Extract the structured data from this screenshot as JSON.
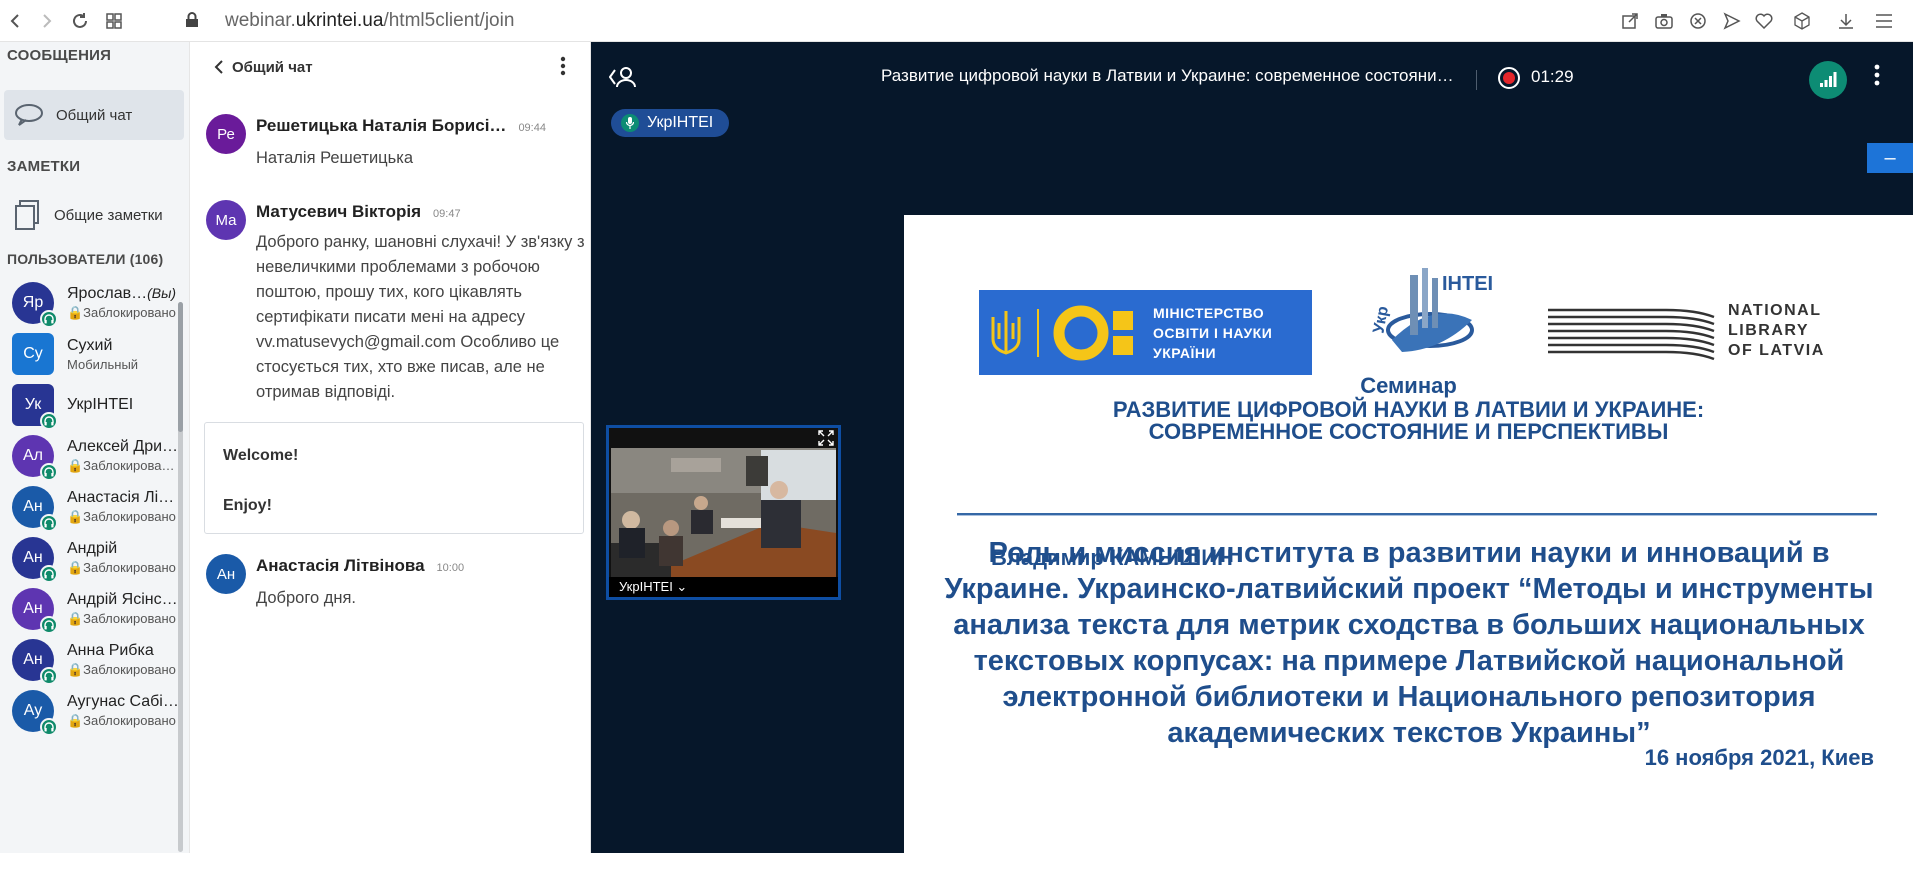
{
  "browser": {
    "url_host_prefix": "webinar.",
    "url_host_main": "ukrintei.ua",
    "url_path": "/html5client/join"
  },
  "sidebar": {
    "messages_title": "СООБЩЕНИЯ",
    "public_chat_label": "Общий чат",
    "notes_title": "ЗАМЕТКИ",
    "shared_notes_label": "Общие заметки",
    "users_title": "ПОЛЬЗОВАТЕЛИ (106)",
    "users": [
      {
        "initials": "Яр",
        "name": "Ярослав…",
        "you": "(Вы)",
        "status": "🔒Заблокировано",
        "color": "#283593",
        "badge": true
      },
      {
        "initials": "Су",
        "name": "Сухий",
        "status": "Мобильный",
        "color": "#1976d2",
        "badge": false,
        "square": true
      },
      {
        "initials": "Ук",
        "name": "УкрІНТЕІ",
        "status": "",
        "color": "#283593",
        "badge": true,
        "square": true
      },
      {
        "initials": "Ал",
        "name": "Алексей Дри…",
        "status": "🔒Заблокирован…",
        "color": "#5e35b1",
        "badge": true
      },
      {
        "initials": "Ан",
        "name": "Анастасія Літ…",
        "status": "🔒Заблокировано",
        "color": "#1a5aa8",
        "badge": true
      },
      {
        "initials": "Ан",
        "name": "Андрій",
        "status": "🔒Заблокировано",
        "color": "#283593",
        "badge": true
      },
      {
        "initials": "Ан",
        "name": "Андрій Ясінс…",
        "status": "🔒Заблокировано",
        "color": "#5e35b1",
        "badge": true
      },
      {
        "initials": "Ан",
        "name": "Анна Рибка",
        "status": "🔒Заблокировано",
        "color": "#283593",
        "badge": true
      },
      {
        "initials": "Ау",
        "name": "Аугунас Сабі…",
        "status": "🔒Заблокировано",
        "color": "#1a5aa8",
        "badge": true
      }
    ]
  },
  "chat": {
    "title": "Общий чат",
    "messages": [
      {
        "initials": "Ре",
        "color": "#6a1b9a",
        "name": "Решетицька Наталія Борисі…",
        "time": "09:44",
        "text": "Наталія Решетицька"
      },
      {
        "initials": "Ма",
        "color": "#5e35b1",
        "name": "Матусевич Вікторія",
        "time": "09:47",
        "text": "Доброго ранку, шановні слухачі! У зв'язку з невеличкими проблемами з робочою поштою, прошу тих, кого цікавлять сертифікати писати мені на адресу vv.matusevych@gmail.com Особливо це стосується тих, хто вже писав, але не отримав відповіді."
      },
      {
        "initials": "Ан",
        "color": "#1a5aa8",
        "name": "Анастасія Літвінова",
        "time": "10:00",
        "text": "Доброго дня."
      }
    ],
    "welcome_line1": "Welcome!",
    "welcome_line2": "Enjoy!"
  },
  "meeting": {
    "title": "Развитие цифровой науки в Латвии и Украине: современное состояние и перспективы",
    "timer": "01:29",
    "talker": "УкрІНТЕІ",
    "video_label": "УкрІНТЕІ ⌄"
  },
  "slide": {
    "ministry": "МІНІСТЕРСТВО ОСВІТИ І НАУКИ УКРАЇНИ",
    "ministry_l1": "МІНІСТЕРСТВО",
    "ministry_l2": "ОСВІТИ І НАУКИ",
    "ministry_l3": "УКРАЇНИ",
    "nll_l1": "NATIONAL",
    "nll_l2": "LIBRARY",
    "nll_l3": "OF LATVIA",
    "seminar": "Семинар",
    "seminar_title_1": "РАЗВИТИЕ ЦИФРОВОЙ НАУКИ В ЛАТВИИ И УКРАИНЕ:",
    "seminar_title_2": "СОВРЕМЕННОЕ СОСТОЯНИЕ И ПЕРСПЕКТИВЫ",
    "speaker": "Владимир КАМЫШИН",
    "talk": "Роль и миссия института в развитии науки и инноваций в Украине. Украинско-латвийский проект “Методы и инструменты анализа текста для метрик сходства в больших национальных текстовых корпусах: на примере Латвийской национальной электронной библиотеки и Национального репозитория академических текстов Украины”",
    "date": "16 ноября 2021, Киев"
  },
  "colors": {
    "accent": "#1d74d8",
    "dark_bg": "#06172a",
    "slide_text": "#1f4e8c",
    "status_green": "#0d8c74"
  }
}
